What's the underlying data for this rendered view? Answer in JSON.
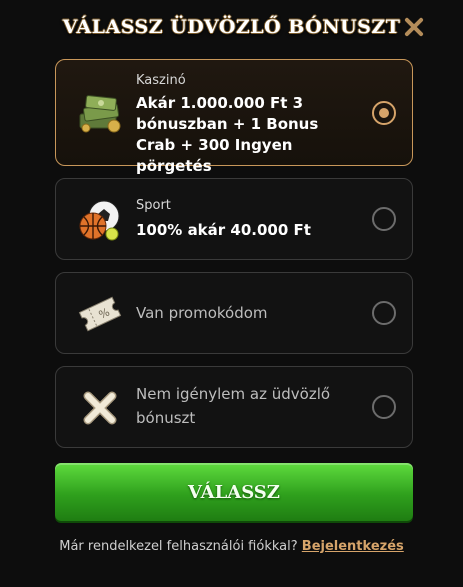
{
  "modal": {
    "title": "VÁLASSZ ÜDVÖZLŐ BÓNUSZT",
    "close_icon": "close-icon"
  },
  "options": [
    {
      "category": "Kaszinó",
      "description": "Akár 1.000.000 Ft 3 bónuszban + 1 Bonus Crab + 300 Ingyen pörgetés",
      "icon": "money-stack-icon",
      "selected": true
    },
    {
      "category": "Sport",
      "description": "100% akár 40.000 Ft",
      "icon": "sports-balls-icon",
      "selected": false
    },
    {
      "description": "Van promokódom",
      "icon": "promo-ticket-icon",
      "selected": false
    },
    {
      "description": "Nem igénylem az üdvözlő bónuszt",
      "icon": "cross-icon",
      "selected": false
    }
  ],
  "cta": {
    "label": "VÁLASSZ"
  },
  "footer": {
    "text": "Már rendelkezel felhasználói fiókkal?",
    "link": "Bejelentkezés"
  },
  "colors": {
    "accent": "#d6a46a",
    "cta_green": "#3fb825",
    "background": "#0d0d0d"
  }
}
